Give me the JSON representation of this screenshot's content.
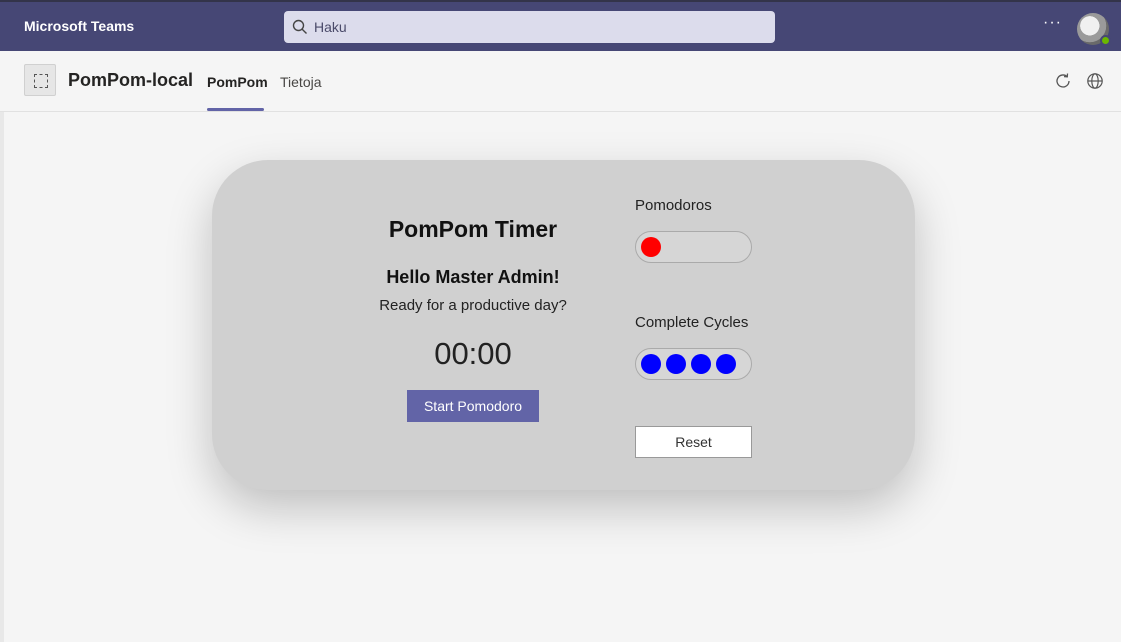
{
  "app": {
    "name": "Microsoft Teams"
  },
  "search": {
    "placeholder": "Haku"
  },
  "topbar": {
    "more_label": "···"
  },
  "header": {
    "title": "PomPom-local",
    "tabs": [
      {
        "label": "PomPom",
        "active": true
      },
      {
        "label": "Tietoja",
        "active": false
      }
    ]
  },
  "card": {
    "title": "PomPom Timer",
    "greeting": "Hello Master Admin!",
    "subtitle": "Ready for a productive day?",
    "timer": "00:00",
    "start_label": "Start Pomodoro",
    "pomodoros_label": "Pomodoros",
    "pomodoros_count": 1,
    "cycles_label": "Complete Cycles",
    "cycles_count": 4,
    "reset_label": "Reset"
  },
  "colors": {
    "teams_purple": "#464775",
    "brand": "#6264a7",
    "pomodoro_dot": "#ff0000",
    "cycle_dot": "#0000ff"
  },
  "icons": [
    "search-icon",
    "more-icon",
    "refresh-icon",
    "globe-icon",
    "app-icon"
  ]
}
